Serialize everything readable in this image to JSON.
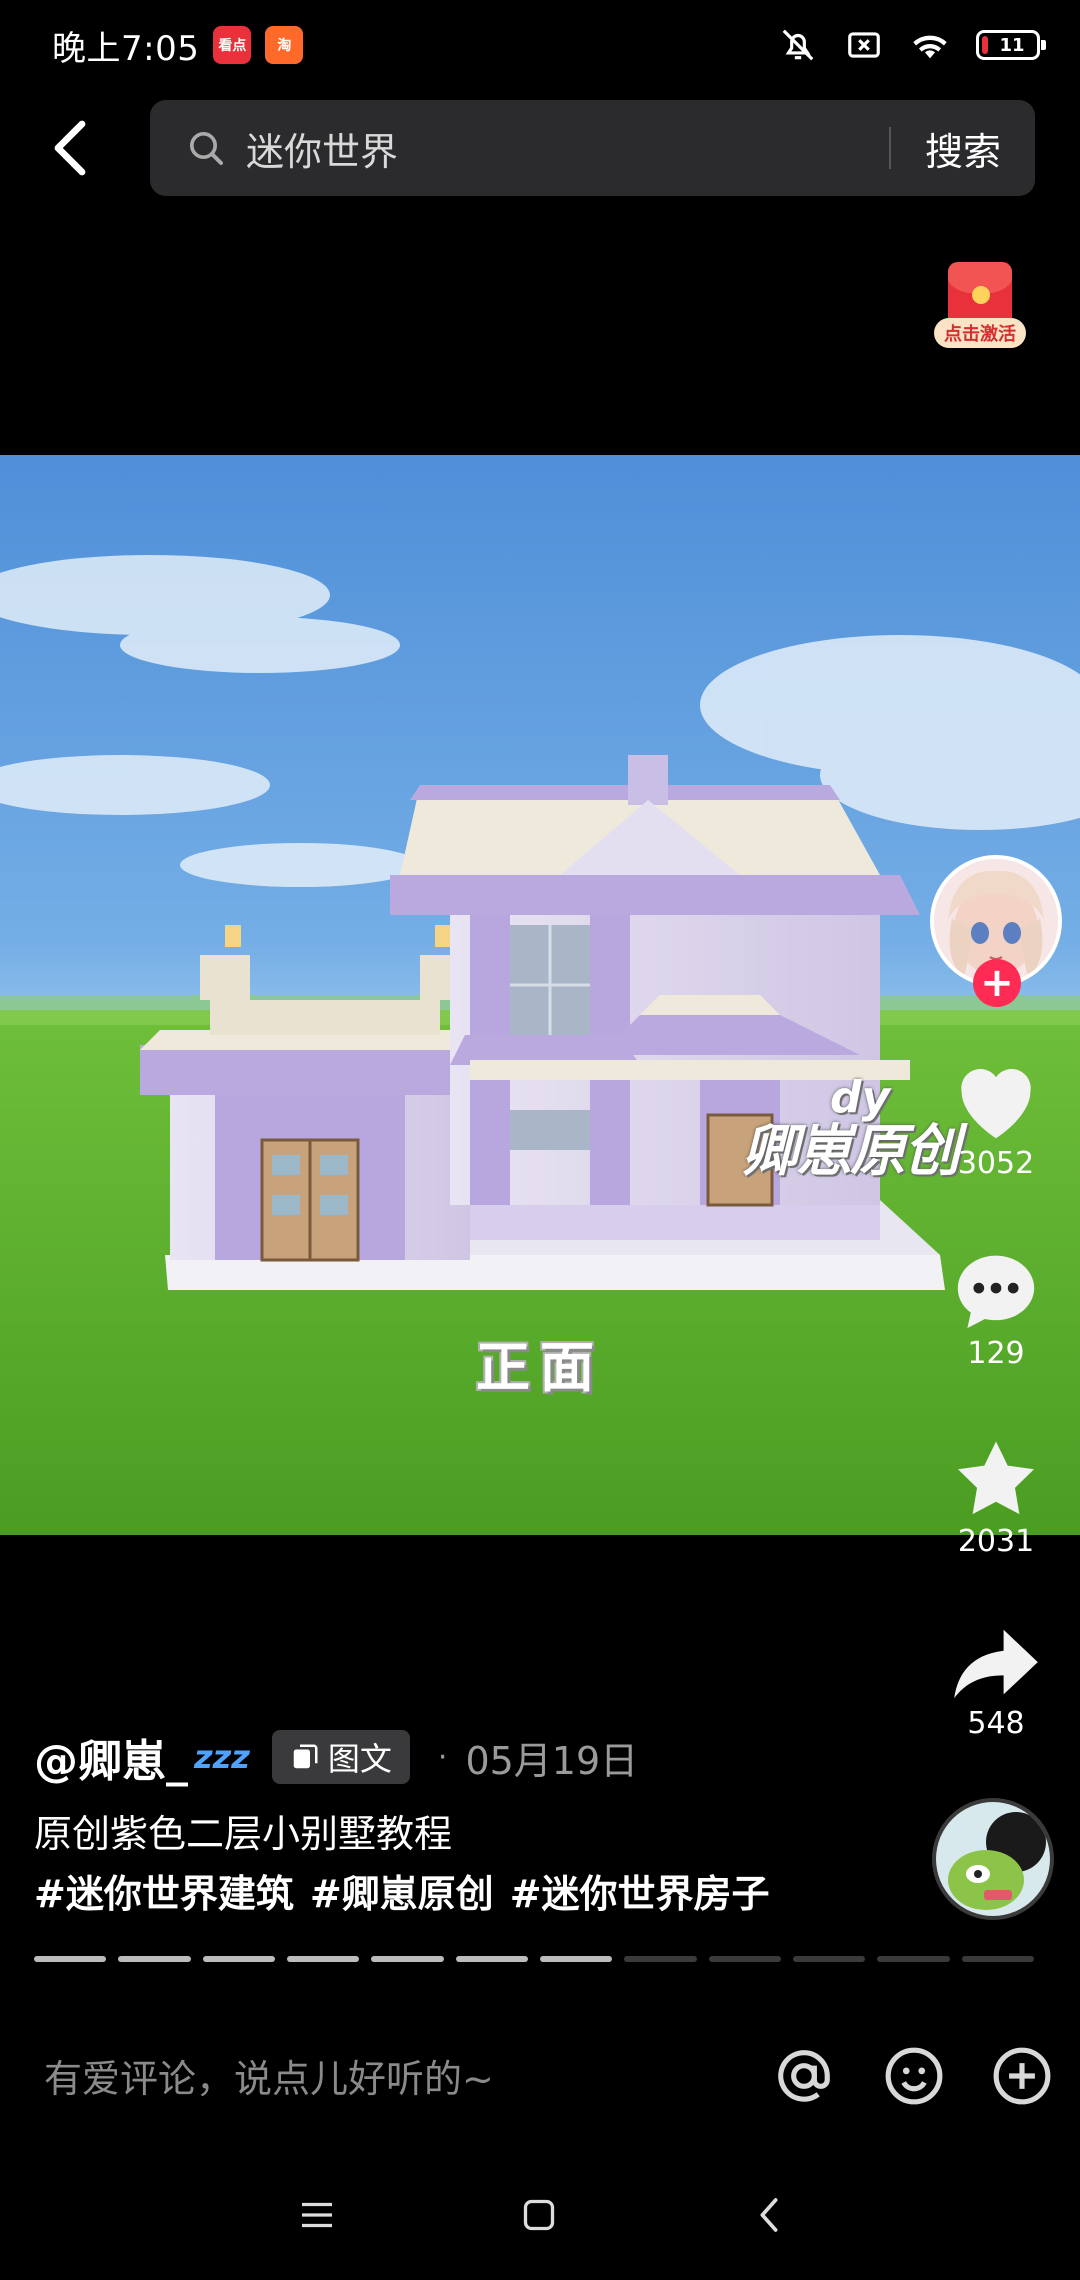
{
  "status_bar": {
    "time": "晚上7:05",
    "app_badge_1": "看点",
    "app_badge_2": "淘",
    "battery_level": "11",
    "battery_fraction": 0.11
  },
  "header": {
    "search_value": "迷你世界",
    "search_button": "搜索"
  },
  "activity": {
    "label": "点击激活"
  },
  "media": {
    "watermark_line1": "dy",
    "watermark_line2": "卿崽原创",
    "caption": "正面"
  },
  "rail": {
    "likes": "3052",
    "comments": "129",
    "favorites": "2031",
    "shares": "548"
  },
  "post": {
    "author": "@卿崽_",
    "author_badge": "zzz",
    "type_chip": "图文",
    "separator": "·",
    "date": "05月19日",
    "title": "原创紫色二层小别墅教程",
    "hashtags": [
      "#迷你世界建筑",
      "#卿崽原创",
      "#迷你世界房子"
    ]
  },
  "progress": {
    "total_segments": 12,
    "completed_segments": 7
  },
  "comment_bar": {
    "placeholder": "有爱评论，说点儿好听的~"
  },
  "colors": {
    "accent": "#fe2c55",
    "background": "#000000",
    "search_bg": "#2b2b2e"
  }
}
